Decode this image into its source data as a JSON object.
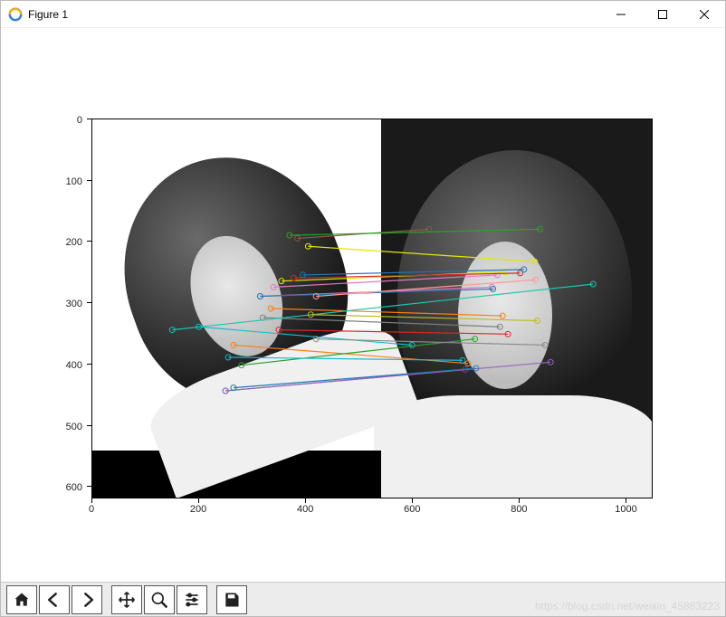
{
  "window": {
    "title": "Figure 1",
    "controls": {
      "minimize": "Minimize",
      "maximize": "Maximize",
      "close": "Close"
    }
  },
  "toolbar": {
    "home": "Home",
    "back": "Back",
    "forward": "Forward",
    "pan": "Pan",
    "zoom": "Zoom",
    "configure": "Configure subplots",
    "save": "Save"
  },
  "chart_data": {
    "type": "scatter",
    "title": "",
    "xlabel": "",
    "ylabel": "",
    "xlim": [
      0,
      1050
    ],
    "ylim": [
      620,
      0
    ],
    "xticks": [
      0,
      200,
      400,
      600,
      800,
      1000
    ],
    "yticks": [
      0,
      100,
      200,
      300,
      400,
      500,
      600
    ],
    "feature_matches": [
      {
        "p1": [
          200,
          340
        ],
        "p2": [
          600,
          370
        ],
        "color": "#17becf"
      },
      {
        "p1": [
          315,
          290
        ],
        "p2": [
          750,
          275
        ],
        "color": "#e377c2"
      },
      {
        "p1": [
          315,
          290
        ],
        "p2": [
          752,
          278
        ],
        "color": "#1f77b4"
      },
      {
        "p1": [
          340,
          275
        ],
        "p2": [
          760,
          255
        ],
        "color": "#e377c2"
      },
      {
        "p1": [
          355,
          265
        ],
        "p2": [
          775,
          250
        ],
        "color": "#e6e600"
      },
      {
        "p1": [
          378,
          260
        ],
        "p2": [
          803,
          252
        ],
        "color": "#d62728"
      },
      {
        "p1": [
          395,
          255
        ],
        "p2": [
          810,
          246
        ],
        "color": "#1f77b4"
      },
      {
        "p1": [
          405,
          208
        ],
        "p2": [
          830,
          233
        ],
        "color": "#e6e600"
      },
      {
        "p1": [
          385,
          195
        ],
        "p2": [
          632,
          180
        ],
        "color": "#8c564b"
      },
      {
        "p1": [
          370,
          190
        ],
        "p2": [
          840,
          180
        ],
        "color": "#2ca02c"
      },
      {
        "p1": [
          335,
          310
        ],
        "p2": [
          770,
          322
        ],
        "color": "#ff7f0e"
      },
      {
        "p1": [
          320,
          325
        ],
        "p2": [
          765,
          340
        ],
        "color": "#7f7f7f"
      },
      {
        "p1": [
          350,
          345
        ],
        "p2": [
          780,
          352
        ],
        "color": "#d62728"
      },
      {
        "p1": [
          265,
          370
        ],
        "p2": [
          705,
          400
        ],
        "color": "#ff7f0e"
      },
      {
        "p1": [
          280,
          403
        ],
        "p2": [
          718,
          360
        ],
        "color": "#2ca02c"
      },
      {
        "p1": [
          255,
          390
        ],
        "p2": [
          695,
          395
        ],
        "color": "#17becf"
      },
      {
        "p1": [
          250,
          445
        ],
        "p2": [
          700,
          410
        ],
        "color": "#6a3d9a"
      },
      {
        "p1": [
          250,
          445
        ],
        "p2": [
          860,
          398
        ],
        "color": "#9467bd"
      },
      {
        "p1": [
          265,
          440
        ],
        "p2": [
          720,
          408
        ],
        "color": "#1f77b4"
      },
      {
        "p1": [
          420,
          290
        ],
        "p2": [
          832,
          263
        ],
        "color": "#ff9896"
      },
      {
        "p1": [
          150,
          345
        ],
        "p2": [
          940,
          270
        ],
        "color": "#17c9b2"
      },
      {
        "p1": [
          410,
          320
        ],
        "p2": [
          835,
          330
        ],
        "color": "#bcbd22"
      },
      {
        "p1": [
          420,
          360
        ],
        "p2": [
          850,
          370
        ],
        "color": "#8b8b8b"
      }
    ],
    "image_panels": {
      "left": {
        "extent_x": [
          0,
          540
        ],
        "extent_y": [
          0,
          540
        ],
        "rotation_deg": -20,
        "content": "grayscale-portrait"
      },
      "right": {
        "extent_x": [
          540,
          1050
        ],
        "extent_y": [
          0,
          540
        ],
        "content": "grayscale-portrait"
      },
      "bottom_strip": {
        "extent_x": [
          0,
          540
        ],
        "extent_y": [
          540,
          620
        ],
        "fill": "#000"
      }
    }
  },
  "watermark": "https://blog.csdn.net/weixin_45883223"
}
